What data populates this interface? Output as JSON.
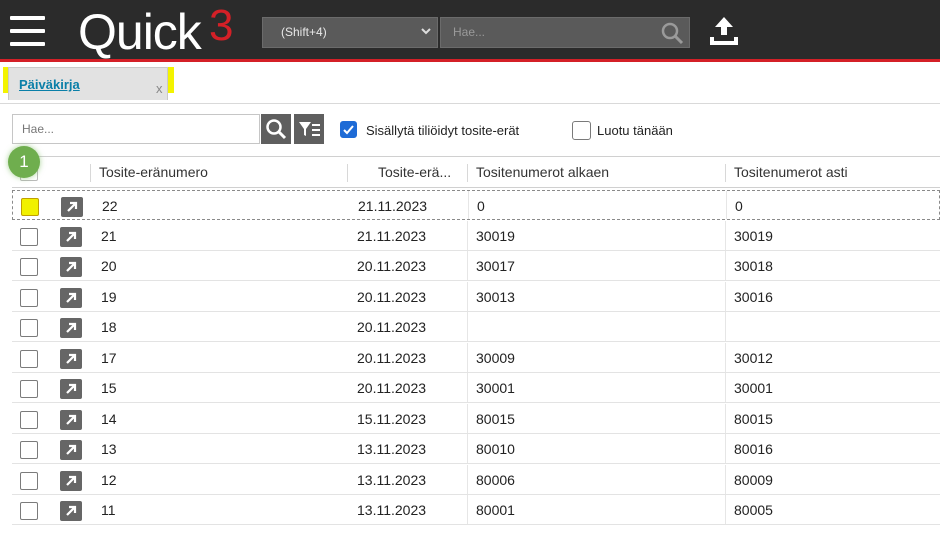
{
  "app": {
    "logo_text": "Quick",
    "logo_superscript": "3"
  },
  "topbar": {
    "shortcut_value": "(Shift+4)",
    "search_placeholder": "Hae...",
    "icons": [
      "menu-icon",
      "chevron-down-icon",
      "search-icon",
      "upload-icon"
    ]
  },
  "tabs": [
    {
      "label": "Päiväkirja",
      "close": "x"
    }
  ],
  "filters": {
    "search_placeholder": "Hae...",
    "include_reconciled_label": "Sisällytä tiliöidyt tosite-erät",
    "include_reconciled_checked": true,
    "created_today_label": "Luotu tänään",
    "created_today_checked": false
  },
  "badge": "1",
  "table": {
    "columns": [
      "Tosite-eränumero",
      "Tosite-erä...",
      "Tositenumerot alkaen",
      "Tositenumerot asti"
    ],
    "rows": [
      {
        "num": "22",
        "date": "21.11.2023",
        "from": "0",
        "to": "0"
      },
      {
        "num": "21",
        "date": "21.11.2023",
        "from": "30019",
        "to": "30019"
      },
      {
        "num": "20",
        "date": "20.11.2023",
        "from": "30017",
        "to": "30018"
      },
      {
        "num": "19",
        "date": "20.11.2023",
        "from": "30013",
        "to": "30016"
      },
      {
        "num": "18",
        "date": "20.11.2023",
        "from": "",
        "to": ""
      },
      {
        "num": "17",
        "date": "20.11.2023",
        "from": "30009",
        "to": "30012"
      },
      {
        "num": "15",
        "date": "20.11.2023",
        "from": "30001",
        "to": "30001"
      },
      {
        "num": "14",
        "date": "15.11.2023",
        "from": "80015",
        "to": "80015"
      },
      {
        "num": "13",
        "date": "13.11.2023",
        "from": "80010",
        "to": "80016"
      },
      {
        "num": "12",
        "date": "13.11.2023",
        "from": "80006",
        "to": "80009"
      },
      {
        "num": "11",
        "date": "13.11.2023",
        "from": "80001",
        "to": "80005"
      }
    ]
  }
}
